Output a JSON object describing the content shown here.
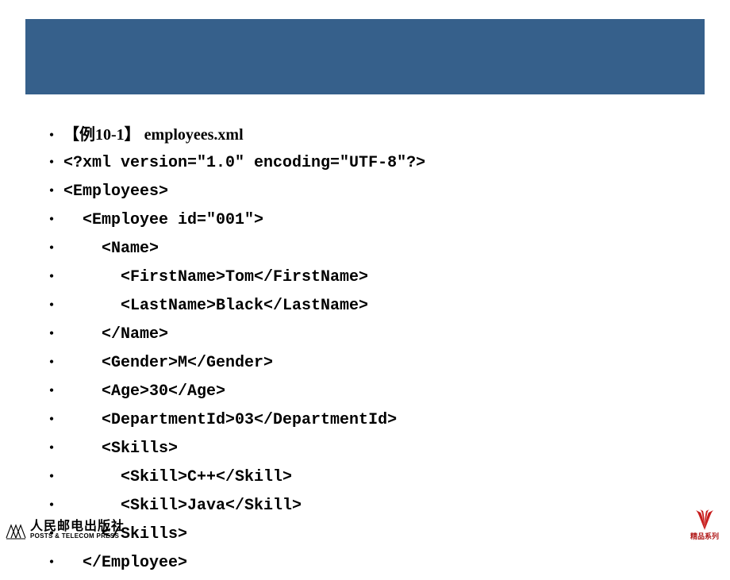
{
  "title_line": "【例10-1】 employees.xml",
  "code_lines": [
    "<?xml version=\"1.0\" encoding=\"UTF-8\"?>",
    "<Employees>",
    "  <Employee id=\"001\">",
    "    <Name>",
    "      <FirstName>Tom</FirstName>",
    "      <LastName>Black</LastName>",
    "    </Name>",
    "    <Gender>M</Gender>",
    "    <Age>30</Age>",
    "    <DepartmentId>03</DepartmentId>",
    "    <Skills>",
    "      <Skill>C++</Skill>",
    "      <Skill>Java</Skill>",
    "    </Skills>",
    "  </Employee>"
  ],
  "publisher": {
    "cn": "人民邮电出版社",
    "en": "POSTS & TELECOM PRESS"
  },
  "series_label": "精品系列"
}
